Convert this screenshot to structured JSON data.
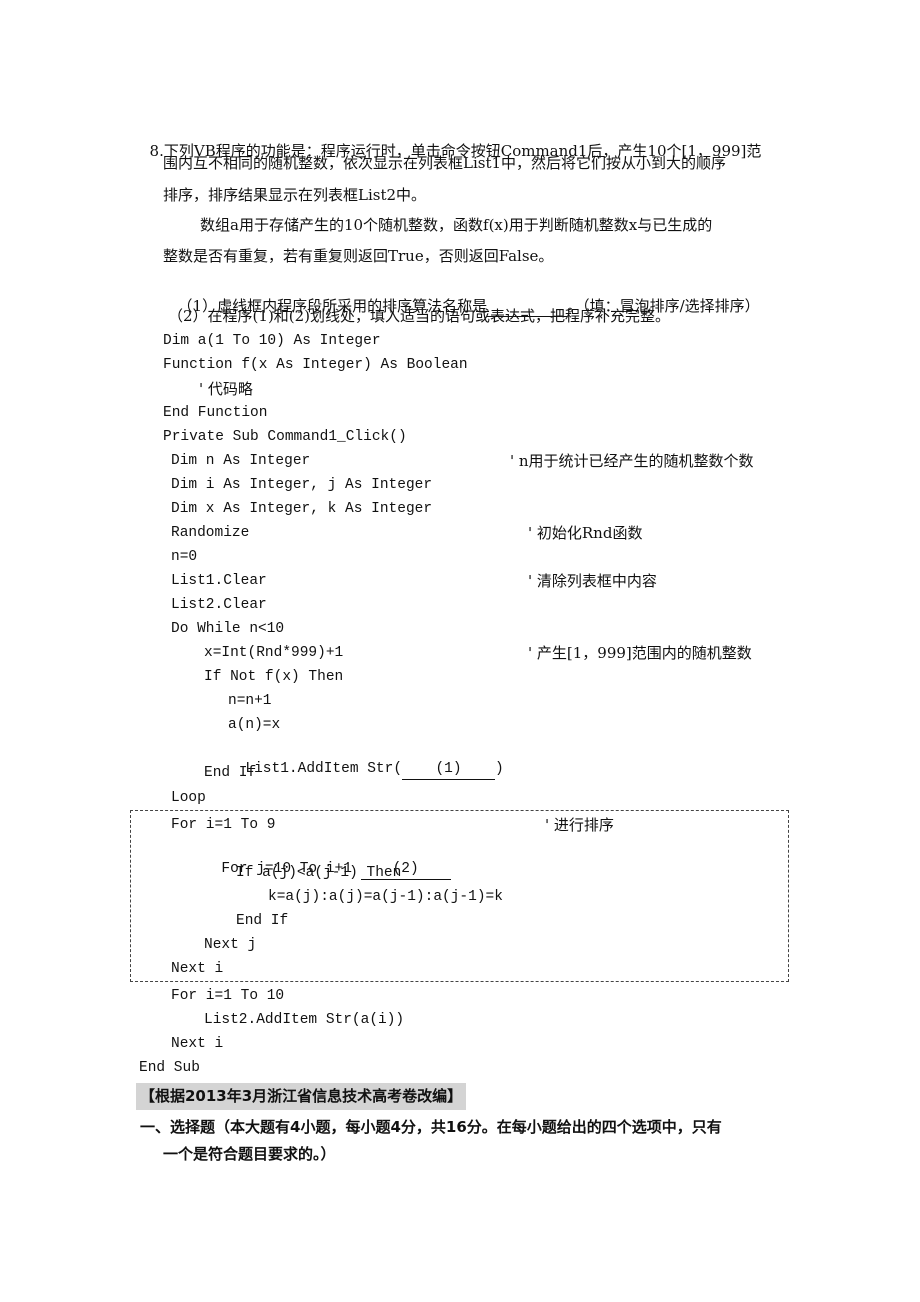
{
  "question": {
    "number": "8.",
    "intro_line1": "下列VB程序的功能是：程序运行时，单击命令按钮Command1后，产生10个[1，999]范",
    "intro_line2": "围内互不相同的随机整数，依次显示在列表框List1中，然后将它们按从小到大的顺序",
    "intro_line3": "排序，排序结果显示在列表框List2中。",
    "para2_line1": "数组a用于存储产生的10个随机整数，函数f(x)用于判断随机整数x与已生成的",
    "para2_line2": "整数是否有重复，若有重复则返回True，否则返回False。",
    "sub1_prefix": "（1）虚线框内程序段所采用的排序算法名称是",
    "sub1_suffix": "。（填：冒泡排序/选择排序）",
    "sub2": "（2）在程序(1)和(2)划线处，填入适当的语句或表达式，把程序补充完整。"
  },
  "code": {
    "l1": "Dim a(1 To 10) As Integer",
    "l2": "Function f(x As Integer) As Boolean",
    "l3": "' 代码略",
    "l4": "End Function",
    "l5": "Private Sub Command1_Click()",
    "l6": "Dim n As Integer",
    "l6c": "' n用于统计已经产生的随机整数个数",
    "l7": "Dim i As Integer, j As Integer",
    "l8": "Dim x As Integer, k As Integer",
    "l9": "Randomize",
    "l9c": "' 初始化Rnd函数",
    "l10": "n=0",
    "l11": "List1.Clear",
    "l11c": "' 清除列表框中内容",
    "l12": "List2.Clear",
    "l13": "Do While n<10",
    "l14": "x=Int(Rnd*999)+1",
    "l14c": "' 产生[1，999]范围内的随机整数",
    "l15": "If Not f(x) Then",
    "l16": "n=n+1",
    "l17": "a(n)=x",
    "l18_prefix": "List1.AddItem Str(",
    "l18_blank": "(1)",
    "l18_suffix": ")",
    "l19": "End If",
    "l20": "Loop",
    "l21": "For i=1 To 9",
    "l21c": "' 进行排序",
    "l22_prefix": "For j=10 To i+1 ",
    "l22_blank": "(2)",
    "l23": "If a(j)<a(j-1) Then",
    "l24": "k=a(j):a(j)=a(j-1):a(j-1)=k",
    "l25": "End If",
    "l26": "Next j",
    "l27": "Next i",
    "l28": "For i=1 To 10",
    "l29": "List2.AddItem Str(a(i))",
    "l30": "Next i",
    "l31": "End Sub"
  },
  "source_note": "【根据2013年3月浙江省信息技术高考卷改编】",
  "section": {
    "line1": "一、选择题（本大题有4小题，每小题4分，共16分。在每小题给出的四个选项中，只有",
    "line2": "一个是符合题目要求的。）"
  }
}
